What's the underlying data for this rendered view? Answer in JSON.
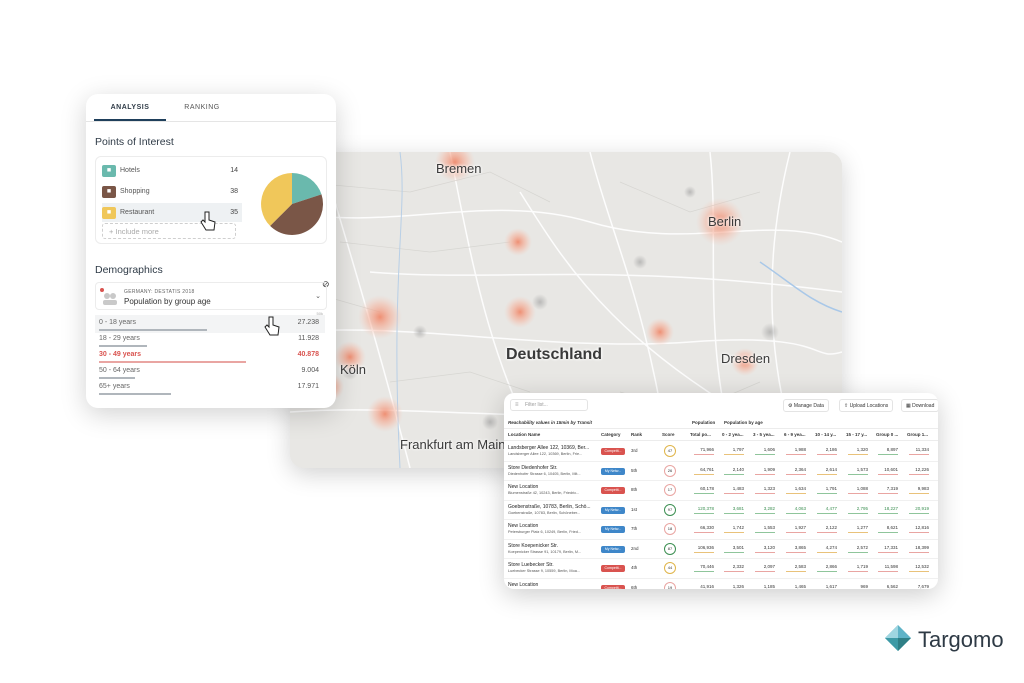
{
  "panel": {
    "tabs": [
      {
        "label": "ANALYSIS"
      },
      {
        "label": "RANKING"
      }
    ],
    "poi_title": "Points of Interest",
    "poi": [
      {
        "label": "Hotels",
        "count": "14",
        "icon": "bed-icon",
        "color": "#6ab9ad"
      },
      {
        "label": "Shopping",
        "count": "38",
        "icon": "cart-icon",
        "color": "#7a5647"
      },
      {
        "label": "Restaurant",
        "count": "35",
        "icon": "cutlery-icon",
        "color": "#f0c75a"
      }
    ],
    "include_more": "Include more",
    "demographics_title": "Demographics",
    "demo_source": "GERMANY: DESTATIS 2018",
    "demo_subtitle": "Population by group age",
    "demo_scale": "50k",
    "ages": [
      {
        "label": "0 - 18 years",
        "value": "27.238",
        "fraction": 0.72
      },
      {
        "label": "18 - 29 years",
        "value": "11.928",
        "fraction": 0.32
      },
      {
        "label": "30 - 49 years",
        "value": "40.878",
        "fraction": 0.98
      },
      {
        "label": "50 - 64 years",
        "value": "9.004",
        "fraction": 0.24
      },
      {
        "label": "65+ years",
        "value": "17.971",
        "fraction": 0.48
      }
    ]
  },
  "map": {
    "cities": [
      "Bremen",
      "Berlin",
      "Deutschland",
      "Dresden",
      "Köln",
      "Frankfurt am Main"
    ]
  },
  "table": {
    "filter_placeholder": "Filter list...",
    "manage_data": "Manage Data",
    "upload_locations": "Upload Locations",
    "download": "Download",
    "note": "Reachability values in 15min by Transit",
    "group_population": "Population",
    "group_age": "Population by age",
    "headers": [
      "Location Name",
      "Category",
      "Rank",
      "Score",
      "Total po...",
      "0 - 2 yea...",
      "3 - 5 yea...",
      "6 - 9 yea...",
      "10 - 14 y...",
      "15 - 17 y...",
      "Group 0 ...",
      "Group 1..."
    ],
    "rows": [
      {
        "name": "Landsberger Allee 122, 10369, Ber...",
        "addr": "Landsberger Allee 122, 10369, Berlin, Frie...",
        "cat": "Competit...",
        "catColor": "#d9534f",
        "rank": "3rd",
        "score": "47",
        "vals": [
          "71,966",
          "1,797",
          "1,606",
          "1,988",
          "2,186",
          "1,320",
          "8,897",
          "11,334"
        ],
        "green": false
      },
      {
        "name": "Store Diedenhofer Str.",
        "addr": "Diedenhofer Strasse 6, 10405, Berlin, Mit...",
        "cat": "My Netw...",
        "catColor": "#3f87c9",
        "rank": "5th",
        "score": "26",
        "vals": [
          "64,761",
          "2,140",
          "1,909",
          "2,364",
          "2,614",
          "1,573",
          "10,601",
          "12,226"
        ],
        "green": false
      },
      {
        "name": "New Location",
        "addr": "Blumenstraße 42, 10243, Berlin, Friedric...",
        "cat": "Competit...",
        "catColor": "#d9534f",
        "rank": "8th",
        "score": "17",
        "vals": [
          "60,178",
          "1,483",
          "1,323",
          "1,634",
          "1,791",
          "1,088",
          "7,319",
          "9,983"
        ],
        "green": false
      },
      {
        "name": "Goebenstraße, 10783, Berlin, Schö...",
        "addr": "Goebenstraße, 10783, Berlin, Schöneber...",
        "cat": "My Netw...",
        "catColor": "#3f87c9",
        "rank": "1st",
        "score": "97",
        "vals": [
          "120,378",
          "3,681",
          "3,282",
          "4,063",
          "4,477",
          "2,795",
          "18,227",
          "20,919"
        ],
        "green": true
      },
      {
        "name": "New Location",
        "addr": "Petersburger Platz 6, 10249, Berlin, Fried...",
        "cat": "My Netw...",
        "catColor": "#3f87c9",
        "rank": "7th",
        "score": "18",
        "vals": [
          "66,330",
          "1,742",
          "1,553",
          "1,927",
          "2,122",
          "1,277",
          "8,621",
          "12,816"
        ],
        "green": false
      },
      {
        "name": "Store Koepenicker Str.",
        "addr": "Koepenicker Strasse 91, 10179, Berlin, M...",
        "cat": "My Netw...",
        "catColor": "#3f87c9",
        "rank": "2nd",
        "score": "87",
        "vals": [
          "106,936",
          "3,501",
          "3,120",
          "3,865",
          "4,274",
          "2,572",
          "17,331",
          "18,399"
        ],
        "green": false
      },
      {
        "name": "Store Luebecker Str.",
        "addr": "Luebecker Strasse 9, 10559, Berlin, Moa...",
        "cat": "Competit...",
        "catColor": "#d9534f",
        "rank": "4th",
        "score": "44",
        "vals": [
          "70,446",
          "2,332",
          "2,097",
          "2,583",
          "2,866",
          "1,719",
          "11,598",
          "12,532"
        ],
        "green": false
      },
      {
        "name": "New Location",
        "addr": "...ersburger Straße 30, 10117, Berlin...",
        "cat": "Competit...",
        "catColor": "#d9534f",
        "rank": "6th",
        "score": "19",
        "vals": [
          "41,916",
          "1,326",
          "1,185",
          "1,465",
          "1,617",
          "969",
          "6,562",
          "7,679"
        ],
        "green": false
      }
    ]
  },
  "brand": {
    "name": "Targomo",
    "colors": {
      "primary": "#2e3a45",
      "accent": "#5fb3c7"
    }
  }
}
